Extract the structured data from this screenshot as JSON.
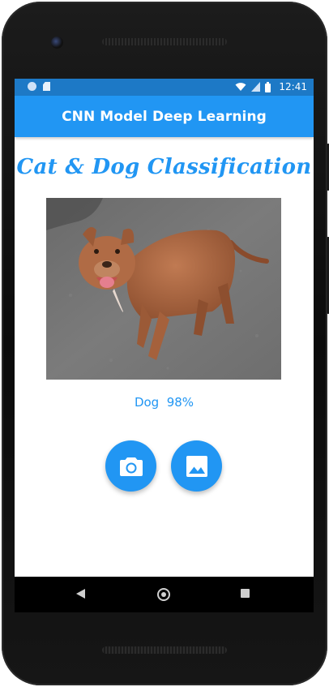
{
  "status_bar": {
    "time": "12:41"
  },
  "app_bar": {
    "title": "CNN Model Deep Learning"
  },
  "main": {
    "headline": "Cat & Dog Classification",
    "result": {
      "label": "Dog",
      "confidence": "98%",
      "text": "Dog  98%"
    },
    "buttons": {
      "camera_icon": "camera-icon",
      "gallery_icon": "image-icon"
    }
  },
  "colors": {
    "primary": "#2196f3",
    "status_bar": "#1d79c6",
    "text_on_primary": "#ffffff"
  },
  "icons": {
    "back": "back-triangle-icon",
    "home": "home-circle-icon",
    "recents": "recents-square-icon"
  }
}
